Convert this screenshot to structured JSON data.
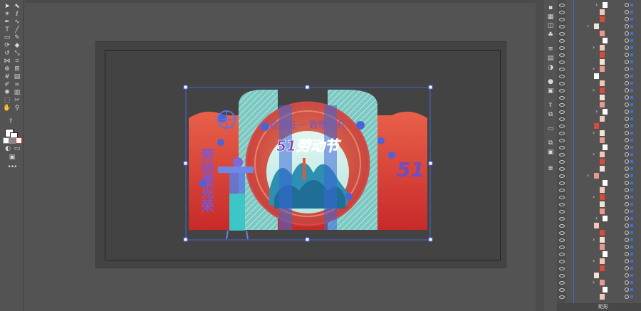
{
  "toolbar": {
    "tools": [
      {
        "icon": "selection-tool-icon",
        "glyph": "➤"
      },
      {
        "icon": "direct-selection-tool-icon",
        "glyph": "⬉"
      },
      {
        "icon": "magic-wand-tool-icon",
        "glyph": "✶"
      },
      {
        "icon": "lasso-tool-icon",
        "glyph": "ℓ"
      },
      {
        "icon": "pen-tool-icon",
        "glyph": "✒"
      },
      {
        "icon": "curvature-tool-icon",
        "glyph": "∿"
      },
      {
        "icon": "type-tool-icon",
        "glyph": "T"
      },
      {
        "icon": "line-tool-icon",
        "glyph": "╱"
      },
      {
        "icon": "rectangle-tool-icon",
        "glyph": "▭"
      },
      {
        "icon": "paintbrush-tool-icon",
        "glyph": "✎"
      },
      {
        "icon": "shaper-tool-icon",
        "glyph": "⟳"
      },
      {
        "icon": "eraser-tool-icon",
        "glyph": "◆"
      },
      {
        "icon": "rotate-tool-icon",
        "glyph": "↺"
      },
      {
        "icon": "scale-tool-icon",
        "glyph": "⤡"
      },
      {
        "icon": "width-tool-icon",
        "glyph": "⋈"
      },
      {
        "icon": "free-transform-tool-icon",
        "glyph": "⌗"
      },
      {
        "icon": "shape-builder-tool-icon",
        "glyph": "⊕"
      },
      {
        "icon": "perspective-grid-tool-icon",
        "glyph": "⊞"
      },
      {
        "icon": "mesh-tool-icon",
        "glyph": "#"
      },
      {
        "icon": "gradient-tool-icon",
        "glyph": "▤"
      },
      {
        "icon": "eyedropper-tool-icon",
        "glyph": "✐"
      },
      {
        "icon": "blend-tool-icon",
        "glyph": "∞"
      },
      {
        "icon": "symbol-sprayer-tool-icon",
        "glyph": "✺"
      },
      {
        "icon": "graph-tool-icon",
        "glyph": "▥"
      },
      {
        "icon": "artboard-tool-icon",
        "glyph": "⬚"
      },
      {
        "icon": "slice-tool-icon",
        "glyph": "✂"
      },
      {
        "icon": "hand-tool-icon",
        "glyph": "✋"
      },
      {
        "icon": "zoom-tool-icon",
        "glyph": "⚲"
      }
    ],
    "help_glyph": "?",
    "more_glyph": "•••"
  },
  "artwork": {
    "banner_text": "欢迎五一 致敬不凡",
    "title_text": "51劳动节",
    "side_title_text": "劳动最光荣",
    "side_number_text": "51"
  },
  "layers_panel": {
    "last_layer_label": "矩形"
  },
  "colors": {
    "accent": "#3f6fd6",
    "selection": "#4a64d8"
  }
}
